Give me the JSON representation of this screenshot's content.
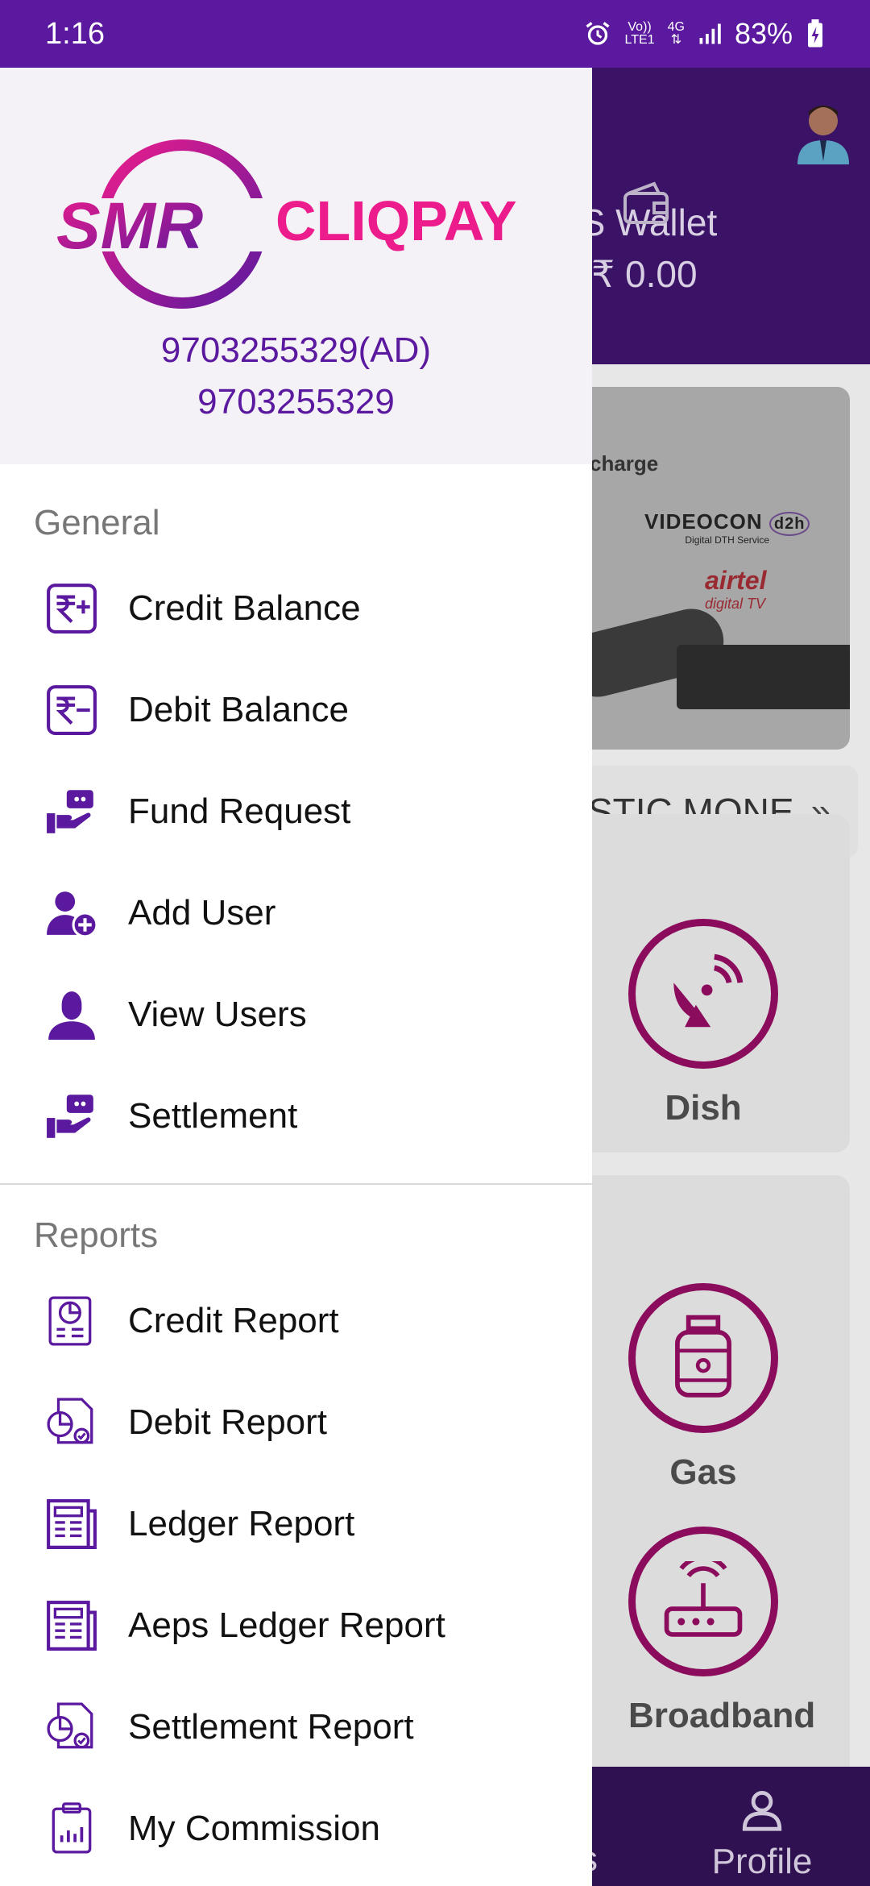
{
  "status_bar": {
    "time": "1:16",
    "network_top": "Vo))",
    "network_bottom": "LTE1",
    "network_type": "4G",
    "battery": "83%",
    "icons": [
      "alarm-icon",
      "signal-icon",
      "battery-charging-icon"
    ]
  },
  "drawer": {
    "brand": {
      "left": "SMR",
      "right": "CLIQPAY"
    },
    "user_line1": "9703255329(AD)",
    "user_line2": "9703255329",
    "sections": {
      "general": {
        "title": "General",
        "items": [
          {
            "label": "Credit Balance",
            "icon": "rupee-plus-icon"
          },
          {
            "label": "Debit Balance",
            "icon": "rupee-minus-icon"
          },
          {
            "label": "Fund Request",
            "icon": "hand-money-icon"
          },
          {
            "label": "Add User",
            "icon": "add-user-icon"
          },
          {
            "label": "View Users",
            "icon": "user-icon"
          },
          {
            "label": "Settlement",
            "icon": "hand-money-icon"
          }
        ]
      },
      "reports": {
        "title": "Reports",
        "items": [
          {
            "label": "Credit Report",
            "icon": "report-chart-icon"
          },
          {
            "label": "Debit Report",
            "icon": "report-check-icon"
          },
          {
            "label": "Ledger Report",
            "icon": "ledger-icon"
          },
          {
            "label": "Aeps Ledger Report",
            "icon": "ledger-icon"
          },
          {
            "label": "Settlement Report",
            "icon": "report-check-icon"
          },
          {
            "label": "My Commission",
            "icon": "commission-icon"
          }
        ]
      }
    }
  },
  "background": {
    "wallet_label": "PS Wallet",
    "wallet_amount": "₹ 0.00",
    "banner": {
      "recharge": "charge",
      "brand1": "VIDEOCON",
      "brand1_sub": "Digital DTH Service",
      "brand1_badge": "d2h",
      "brand2": "airtel",
      "brand2_sub": "digital TV"
    },
    "ticker": "STIC MONE",
    "services": [
      "Dish",
      "Gas",
      "Broadband"
    ],
    "bottom_nav": {
      "partial": "s",
      "profile": "Profile"
    }
  },
  "colors": {
    "primary": "#5a199e",
    "accent": "#8b0c5c",
    "logo_pink": "#ec1c8c"
  }
}
